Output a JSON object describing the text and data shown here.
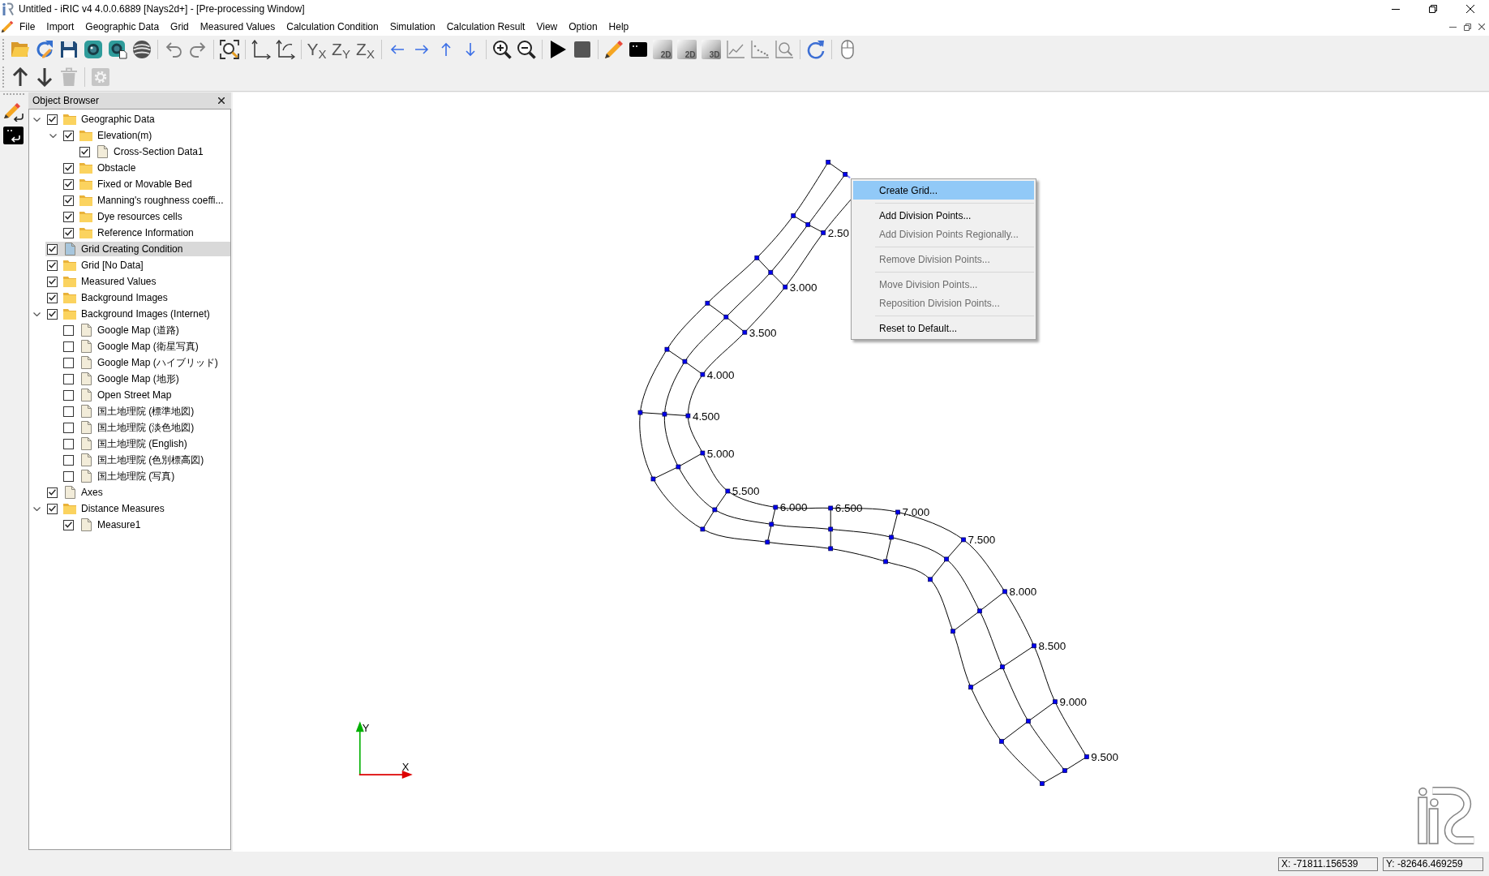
{
  "window": {
    "title": "Untitled - iRIC v4 4.0.0.6889 [Nays2d+] - [Pre-processing Window]"
  },
  "menu_bar": [
    "File",
    "Import",
    "Geographic Data",
    "Grid",
    "Measured Values",
    "Calculation Condition",
    "Simulation",
    "Calculation Result",
    "View",
    "Option",
    "Help"
  ],
  "toolbar": {
    "view_buttons": [
      "Y$_{X}$",
      "Z$_{Y}$",
      "Z$_{X}$"
    ],
    "dimension_buttons": [
      "2D",
      "2D",
      "3D"
    ]
  },
  "toolbar_2": [
    {
      "disabled": false
    },
    {
      "disabled": false
    },
    {
      "disabled": true
    },
    {
      "disabled": true
    }
  ],
  "object_browser": {
    "title": "Object Browser",
    "items": [
      {
        "label": "Geographic Data",
        "kind": "folder",
        "checked": true,
        "selected": false,
        "expanded": true,
        "children": [
          {
            "label": "Elevation(m)",
            "kind": "folder",
            "checked": true,
            "selected": false,
            "expanded": true,
            "children": [
              {
                "label": "Cross-Section Data1",
                "kind": "file",
                "checked": true,
                "selected": false
              }
            ]
          },
          {
            "label": "Obstacle",
            "kind": "folder",
            "checked": true,
            "selected": false
          },
          {
            "label": "Fixed or Movable Bed",
            "kind": "folder",
            "checked": true,
            "selected": false
          },
          {
            "label": "Manning's roughness coeffi...",
            "kind": "folder",
            "checked": true,
            "selected": false
          },
          {
            "label": "Dye resources cells",
            "kind": "folder",
            "checked": true,
            "selected": false
          },
          {
            "label": "Reference Information",
            "kind": "folder",
            "checked": true,
            "selected": false
          }
        ]
      },
      {
        "label": "Grid Creating Condition",
        "kind": "file",
        "checked": true,
        "selected": true
      },
      {
        "label": "Grid [No Data]",
        "kind": "folder",
        "checked": true,
        "selected": false
      },
      {
        "label": "Measured Values",
        "kind": "folder",
        "checked": true,
        "selected": false
      },
      {
        "label": "Background Images",
        "kind": "folder",
        "checked": true,
        "selected": false
      },
      {
        "label": "Background Images (Internet)",
        "kind": "folder",
        "checked": true,
        "selected": false,
        "expanded": true,
        "children": [
          {
            "label": "Google Map (道路)",
            "kind": "file",
            "checked": false,
            "selected": false
          },
          {
            "label": "Google Map (衛星写真)",
            "kind": "file",
            "checked": false,
            "selected": false
          },
          {
            "label": "Google Map (ハイブリッド)",
            "kind": "file",
            "checked": false,
            "selected": false
          },
          {
            "label": "Google Map (地形)",
            "kind": "file",
            "checked": false,
            "selected": false
          },
          {
            "label": "Open Street Map",
            "kind": "file",
            "checked": false,
            "selected": false
          },
          {
            "label": "国土地理院 (標準地図)",
            "kind": "file",
            "checked": false,
            "selected": false
          },
          {
            "label": "国土地理院 (淡色地図)",
            "kind": "file",
            "checked": false,
            "selected": false
          },
          {
            "label": "国土地理院 (English)",
            "kind": "file",
            "checked": false,
            "selected": false
          },
          {
            "label": "国土地理院 (色別標高図)",
            "kind": "file",
            "checked": false,
            "selected": false
          },
          {
            "label": "国土地理院 (写真)",
            "kind": "file",
            "checked": false,
            "selected": false
          }
        ]
      },
      {
        "label": "Axes",
        "kind": "file",
        "checked": true,
        "selected": false
      },
      {
        "label": "Distance Measures",
        "kind": "folder",
        "checked": true,
        "selected": false,
        "expanded": true,
        "children": [
          {
            "label": "Measure1",
            "kind": "file",
            "checked": true,
            "selected": false
          }
        ]
      }
    ]
  },
  "canvas": {
    "station_labels": [
      "2.50",
      "3.000",
      "3.500",
      "4.000",
      "4.500",
      "5.000",
      "5.500",
      "6.000",
      "6.500",
      "7.000",
      "7.500",
      "8.000",
      "8.500",
      "9.000",
      "9.500"
    ],
    "axes": {
      "x_label": "X",
      "y_label": "Y"
    }
  },
  "context_menu": {
    "groups": [
      [
        {
          "label": "Create Grid...",
          "selected": true,
          "disabled": false
        }
      ],
      [
        {
          "label": "Add Division Points...",
          "selected": false,
          "disabled": false
        },
        {
          "label": "Add Division Points Regionally...",
          "selected": false,
          "disabled": true
        }
      ],
      [
        {
          "label": "Remove Division Points...",
          "selected": false,
          "disabled": true
        }
      ],
      [
        {
          "label": "Move Division Points...",
          "selected": false,
          "disabled": true
        },
        {
          "label": "Reposition Division Points...",
          "selected": false,
          "disabled": true
        }
      ],
      [
        {
          "label": "Reset to Default...",
          "selected": false,
          "disabled": false
        }
      ]
    ]
  },
  "status_bar": {
    "x": "X: -71811.156539",
    "y": "Y: -82646.469259"
  }
}
